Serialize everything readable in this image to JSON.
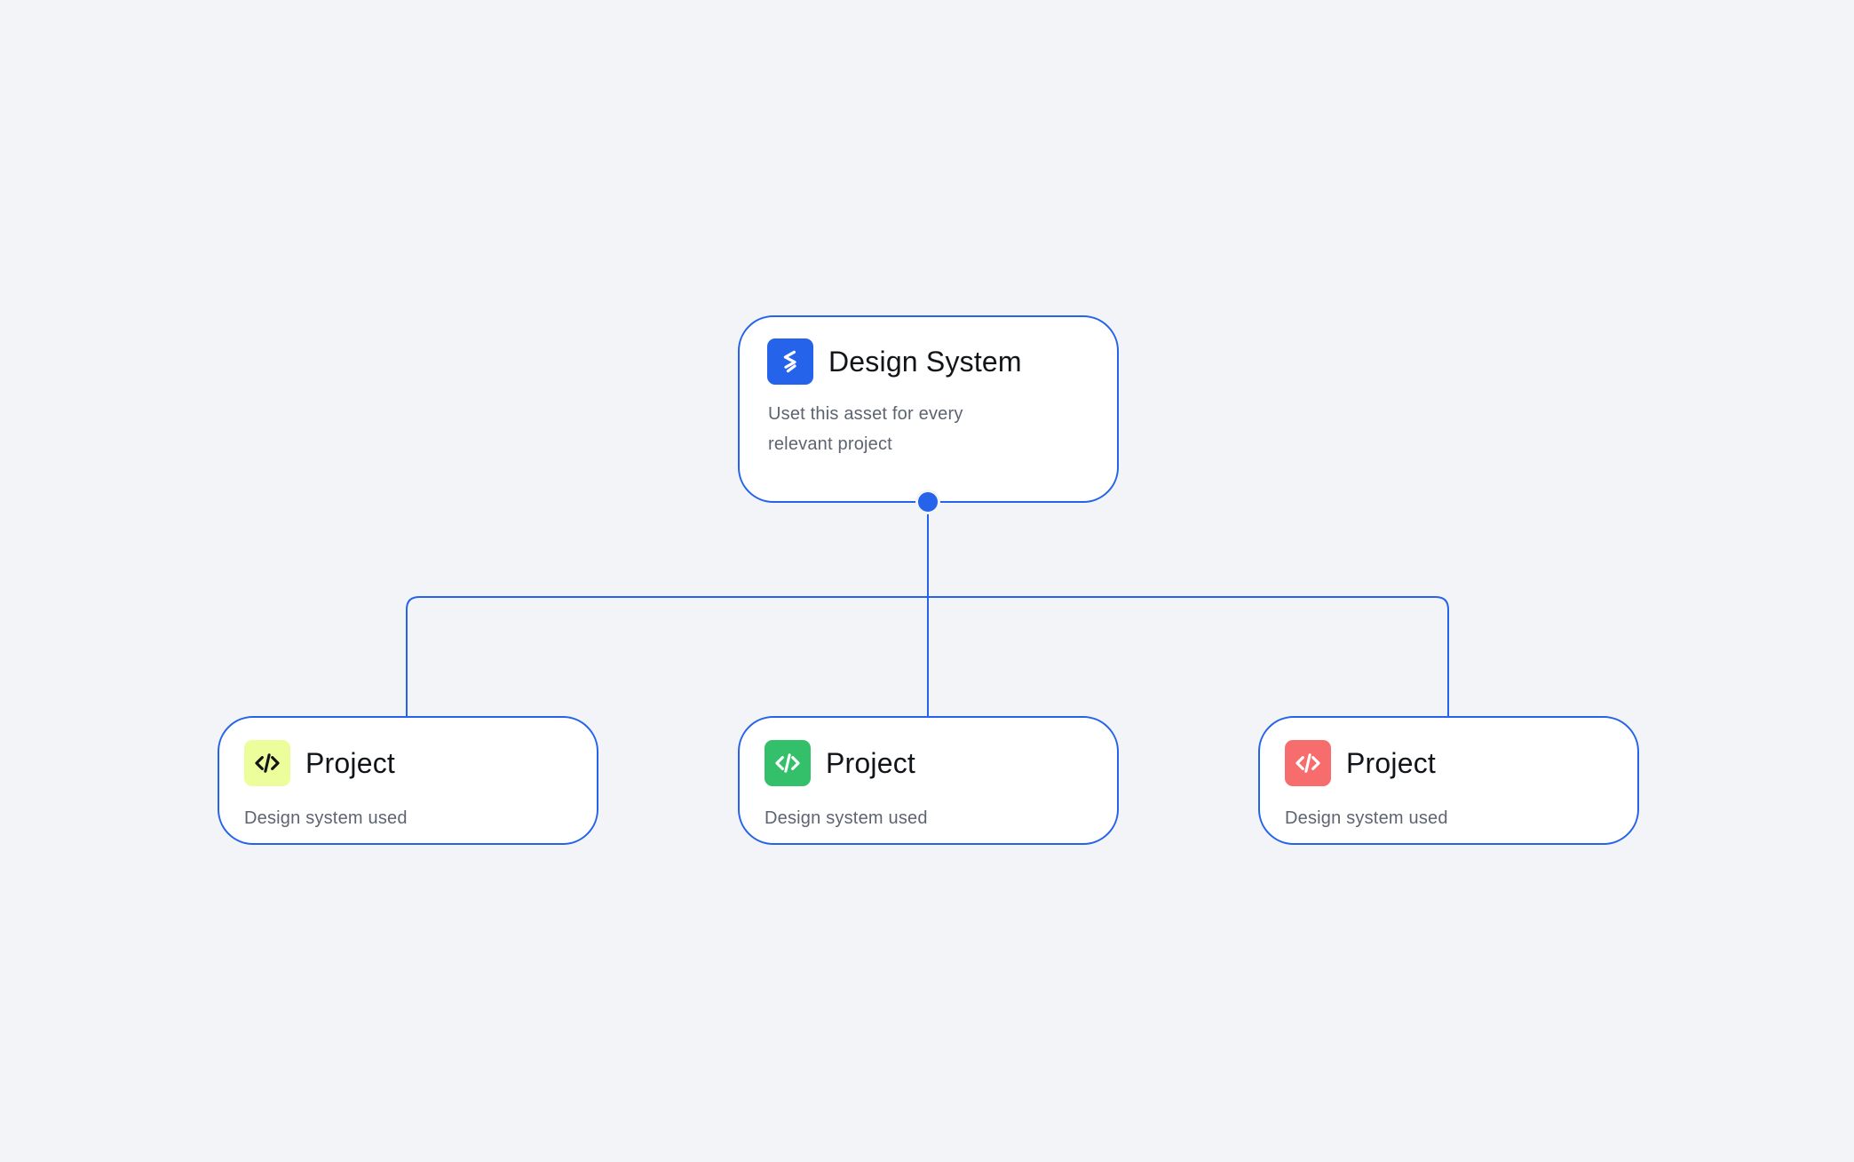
{
  "diagram": {
    "accent_color": "#2563eb",
    "root": {
      "title": "Design System",
      "description": "Uset this asset for every relevant project",
      "icon": "layers-stack-icon",
      "icon_bg": "#2563eb",
      "icon_color": "#ffffff"
    },
    "children": [
      {
        "title": "Project",
        "description": "Design system used",
        "icon": "code-icon",
        "icon_bg": "#ecfd9c",
        "icon_color": "#111418"
      },
      {
        "title": "Project",
        "description": "Design system used",
        "icon": "code-icon",
        "icon_bg": "#34c06a",
        "icon_color": "#ffffff"
      },
      {
        "title": "Project",
        "description": "Design system used",
        "icon": "code-icon",
        "icon_bg": "#f76d6d",
        "icon_color": "#ffffff"
      }
    ]
  }
}
